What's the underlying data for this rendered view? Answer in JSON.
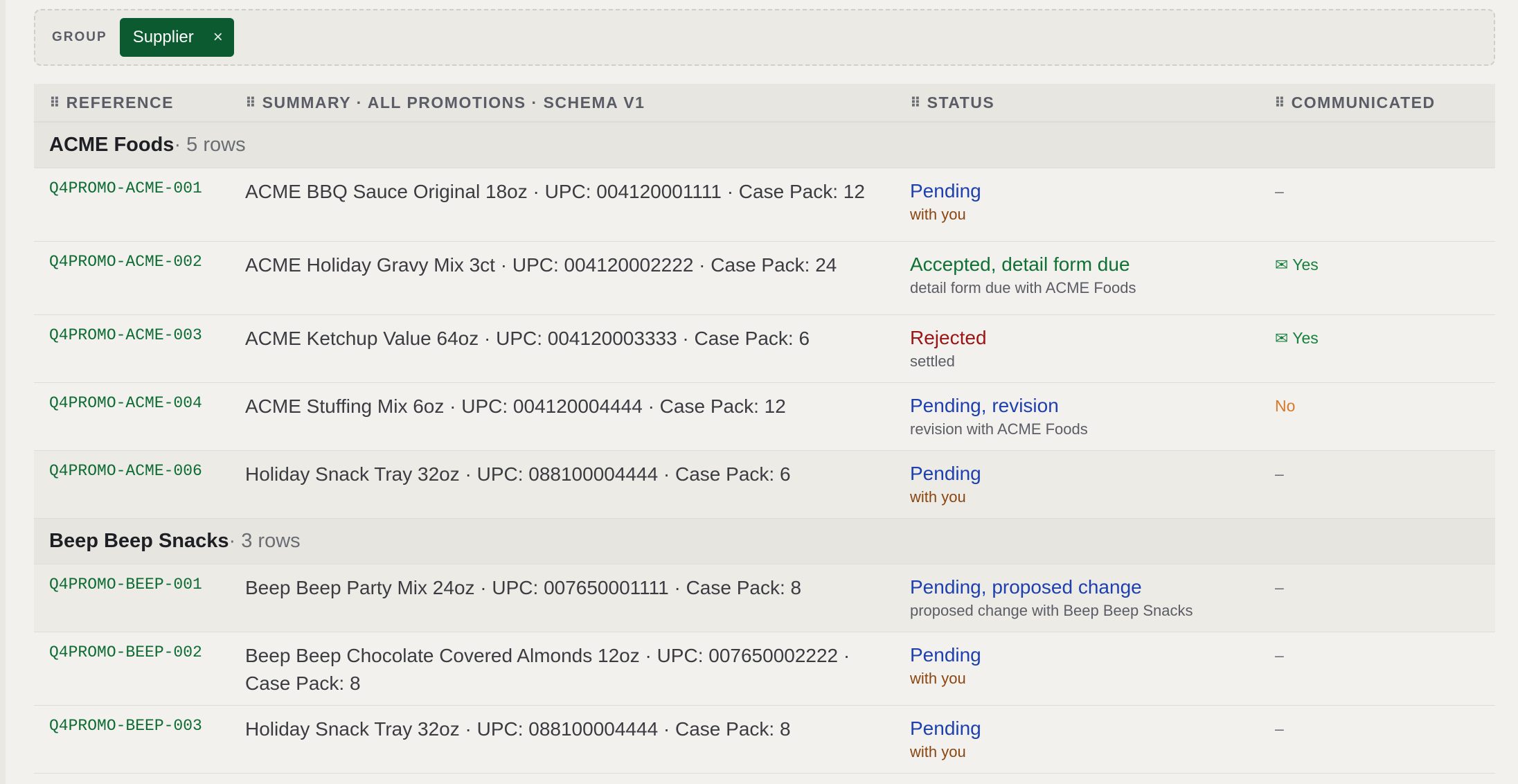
{
  "group_bar": {
    "label": "GROUP",
    "chip": "Supplier",
    "chip_close": "×"
  },
  "columns": {
    "grip": "⠿",
    "reference": "REFERENCE",
    "summary": "SUMMARY · ALL PROMOTIONS · SCHEMA V1",
    "status": "STATUS",
    "communicated": "COMMUNICATED"
  },
  "groups": [
    {
      "name": "ACME Foods",
      "count": " · 5 rows",
      "rows": [
        {
          "ref": "Q4PROMO-ACME-001",
          "summary": "ACME BBQ Sauce Original 18oz · UPC: 004120001111 · Case Pack: 12",
          "status": "Pending",
          "status_color": "#1d3fb0",
          "sub": "with you",
          "sub_color": "#8a4510",
          "comm": "–",
          "comm_type": "dash"
        },
        {
          "ref": "Q4PROMO-ACME-002",
          "summary": "ACME Holiday Gravy Mix 3ct · UPC: 004120002222 · Case Pack: 24",
          "status": "Accepted, detail form due",
          "status_color": "#107034",
          "sub": "detail form due with ACME Foods",
          "sub_color": "#5b5d66",
          "comm": "✉ Yes",
          "comm_type": "yes"
        },
        {
          "ref": "Q4PROMO-ACME-003",
          "summary": "ACME Ketchup Value 64oz · UPC: 004120003333 · Case Pack: 6",
          "status": "Rejected",
          "status_color": "#9a1515",
          "sub": "settled",
          "sub_color": "#5b5d66",
          "comm": "✉ Yes",
          "comm_type": "yes"
        },
        {
          "ref": "Q4PROMO-ACME-004",
          "summary": "ACME Stuffing Mix 6oz · UPC: 004120004444 · Case Pack: 12",
          "status": "Pending, revision",
          "status_color": "#1d3fb0",
          "sub": "revision with ACME Foods",
          "sub_color": "#5b5d66",
          "comm": "No",
          "comm_type": "no"
        },
        {
          "ref": "Q4PROMO-ACME-006",
          "summary": "Holiday Snack Tray 32oz · UPC: 088100004444 · Case Pack: 6",
          "status": "Pending",
          "status_color": "#1d3fb0",
          "sub": "with you",
          "sub_color": "#8a4510",
          "comm": "–",
          "comm_type": "dash"
        }
      ]
    },
    {
      "name": "Beep Beep Snacks",
      "count": " · 3 rows",
      "rows": [
        {
          "ref": "Q4PROMO-BEEP-001",
          "summary": "Beep Beep Party Mix 24oz · UPC: 007650001111 · Case Pack: 8",
          "status": "Pending, proposed change",
          "status_color": "#1d3fb0",
          "sub": "proposed change with Beep Beep Snacks",
          "sub_color": "#5b5d66",
          "comm": "–",
          "comm_type": "dash"
        },
        {
          "ref": "Q4PROMO-BEEP-002",
          "summary": "Beep Beep Chocolate Covered Almonds 12oz · UPC: 007650002222 · Case Pack: 8",
          "status": "Pending",
          "status_color": "#1d3fb0",
          "sub": "with you",
          "sub_color": "#8a4510",
          "comm": "–",
          "comm_type": "dash"
        },
        {
          "ref": "Q4PROMO-BEEP-003",
          "summary": "Holiday Snack Tray 32oz · UPC: 088100004444 · Case Pack: 8",
          "status": "Pending",
          "status_color": "#1d3fb0",
          "sub": "with you",
          "sub_color": "#8a4510",
          "comm": "–",
          "comm_type": "dash"
        }
      ]
    }
  ]
}
